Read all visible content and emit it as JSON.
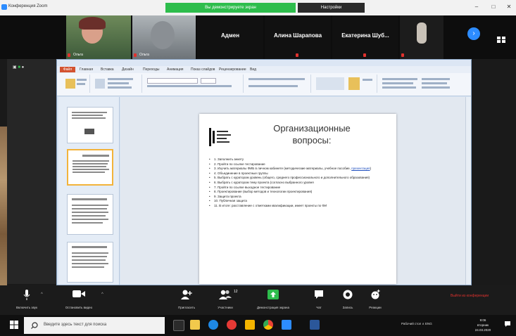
{
  "window": {
    "title": "Конференция Zoom",
    "share_banner": "Вы демонстрируете экран",
    "share_settings": "Настройки",
    "min": "–",
    "max": "□",
    "close": "✕"
  },
  "participants": [
    {
      "name": "Ольга",
      "muted": true
    },
    {
      "name": "Ольга",
      "muted": true
    },
    {
      "name": "Адмен",
      "muted": false
    },
    {
      "name": "Алина Шарапова",
      "muted": true
    },
    {
      "name": "Екатерина Шуб...",
      "muted": true
    },
    {
      "name": "",
      "muted": true
    }
  ],
  "strip": {
    "next_label": "›"
  },
  "ppt": {
    "title": "",
    "file_tab": "Файл",
    "tabs": [
      "Главная",
      "Вставка",
      "Дизайн",
      "Переходы",
      "Анимация",
      "Показ слайдов",
      "Рецензирование",
      "Вид"
    ]
  },
  "slide": {
    "title_line1": "Организационные",
    "title_line2": "вопросы:",
    "items": [
      "1. Заполнить анкету",
      "2. Пройти по ссылке тестирование",
      "3. Изучить материалы ФИБ в личном кабинете (методические материалы, учебное пособие, презентация)",
      "4. Объединение в проектные группы",
      "5. Выбрать с куратором уровень (общего, среднего профессионального и дополнительного образования)",
      "6. Выбрать с куратором тему проекта (согласно выбранного уровня",
      "7. Пройти по ссылке выходное тестирование",
      "8. Проектирование (выбор методов и технологии проектирования)",
      "9. Защита проекта",
      "10. Публичная защита",
      "11. В итоге: расставление с отметками квалификации, имеет проекты по ФИ"
    ],
    "link_word": "презентация"
  },
  "controls": [
    {
      "label": "Включить звук",
      "icon": "mic-icon"
    },
    {
      "label": "Остановить видео",
      "icon": "video-icon"
    },
    {
      "label": "Пригласить",
      "icon": "invite-icon"
    },
    {
      "label": "Участники",
      "icon": "participants-icon",
      "count": "12"
    },
    {
      "label": "Демонстрация экрана",
      "icon": "share-icon"
    },
    {
      "label": "Чат",
      "icon": "chat-icon"
    },
    {
      "label": "Запись",
      "icon": "record-icon"
    },
    {
      "label": "Реакции",
      "icon": "reactions-icon"
    }
  ],
  "end_button": "Выйти из конференции",
  "taskbar": {
    "search_placeholder": "Введите здесь текст для поиска",
    "tray": "Рабочий стол   ∧   ENG",
    "time": "9:06",
    "weekday": "вторник",
    "date": "24.03.2020"
  },
  "colors": {
    "zoom_blue": "#2d8cff",
    "share_green": "#2ebd4c",
    "end_red": "#e0322e",
    "ppt_orange": "#d35230"
  }
}
